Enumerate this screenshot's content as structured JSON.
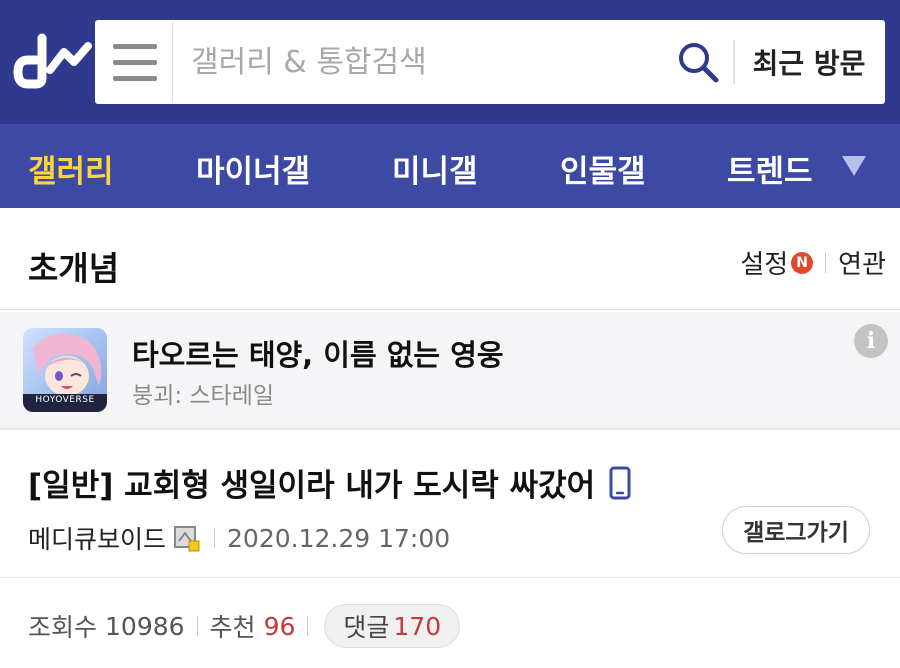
{
  "header": {
    "logo_text": "dc",
    "search_placeholder": "갤러리 & 통합검색",
    "recent_label": "최근 방문"
  },
  "nav": {
    "items": [
      {
        "label": "갤러리",
        "active": true
      },
      {
        "label": "마이너갤",
        "active": false
      },
      {
        "label": "미니갤",
        "active": false
      },
      {
        "label": "인물갤",
        "active": false
      },
      {
        "label": "트렌드",
        "active": false
      }
    ]
  },
  "gallery": {
    "title": "초개념",
    "settings_label": "설정",
    "new_badge": "N",
    "related_label": "연관"
  },
  "ad": {
    "title": "타오르는 태양, 이름 없는 영웅",
    "subtitle": "붕괴: 스타레일",
    "thumb_brand": "HOYOVERSE",
    "info_icon": "i"
  },
  "post": {
    "title": "[일반] 교회형 생일이라 내가 도시락 싸갔어",
    "author": "메디큐보이드",
    "date": "2020.12.29 17:00",
    "gallog_label": "갤로그가기"
  },
  "stats": {
    "views_label": "조회수",
    "views": "10986",
    "recommend_label": "추천",
    "recommend": "96",
    "comments_label": "댓글",
    "comments": "170"
  },
  "colors": {
    "header_bg": "#2f3a8f",
    "nav_bg": "#3d4aa3",
    "active_nav": "#ffd53a",
    "accent_red": "#c43a3a"
  }
}
